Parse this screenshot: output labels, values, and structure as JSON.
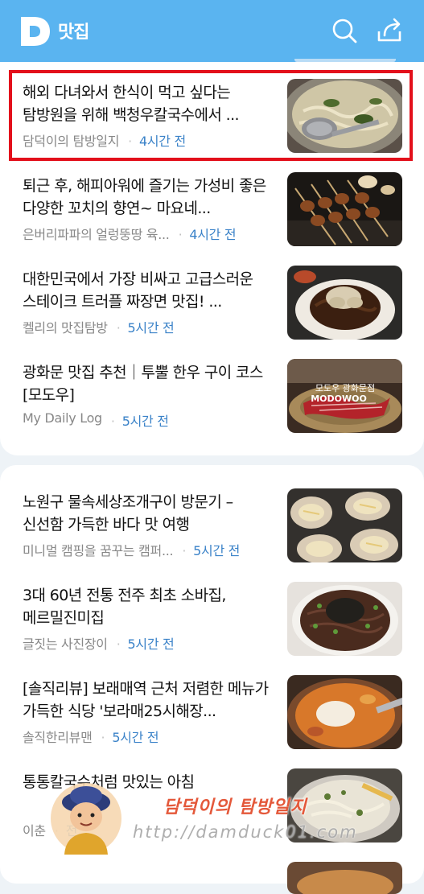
{
  "header": {
    "brand": "맛집",
    "colors": {
      "bar": "#5ab4f0",
      "highlight": "#e3101b",
      "time": "#3a82c8"
    }
  },
  "section1": [
    {
      "title": "해외 다녀와서 한식이 먹고 싶다는 탐방원을 위해 백청우칼국수에서 ...",
      "source": "담덕이의 탐방일지",
      "time": "4시간 전",
      "highlighted": true
    },
    {
      "title": "퇴근 후, 해피아워에 즐기는 가성비 좋은 다양한 꼬치의 향연~ 마요네...",
      "source": "은버리파파의 얼렁뚱땅 육...",
      "time": "4시간 전"
    },
    {
      "title": "대한민국에서 가장 비싸고 고급스러운 스테이크 트러플 짜장면 맛집! ...",
      "source": "켈리의 맛집탐방",
      "time": "5시간 전"
    },
    {
      "title": "광화문 맛집 추천｜투뿔 한우 구이 코스 [모도우]",
      "source": "My Daily Log",
      "time": "5시간 전",
      "thumb_text": [
        "모도우 광화문점",
        "MODOWOO"
      ]
    }
  ],
  "section2": [
    {
      "title": "노원구 물속세상조개구이 방문기 – 신선함 가득한 바다 맛 여행",
      "source": "미니멀 캠핑을 꿈꾸는 캠퍼...",
      "time": "5시간 전"
    },
    {
      "title": "3대 60년 전통 전주 최초 소바집, 메르밀진미집",
      "source": "글짓는 사진장이",
      "time": "5시간 전"
    },
    {
      "title": "[솔직리뷰] 보래매역 근처 저렴한 메뉴가 가득한 식당 '보라매25시해장...",
      "source": "솔직한리뷰맨",
      "time": "5시간 전"
    },
    {
      "title": "통통칼국수처럼 맛있는 아침",
      "source": "이춘",
      "time": "전"
    }
  ],
  "watermark": {
    "name": "담덕이의 탐방일지",
    "url": "http://damduck01.com"
  }
}
